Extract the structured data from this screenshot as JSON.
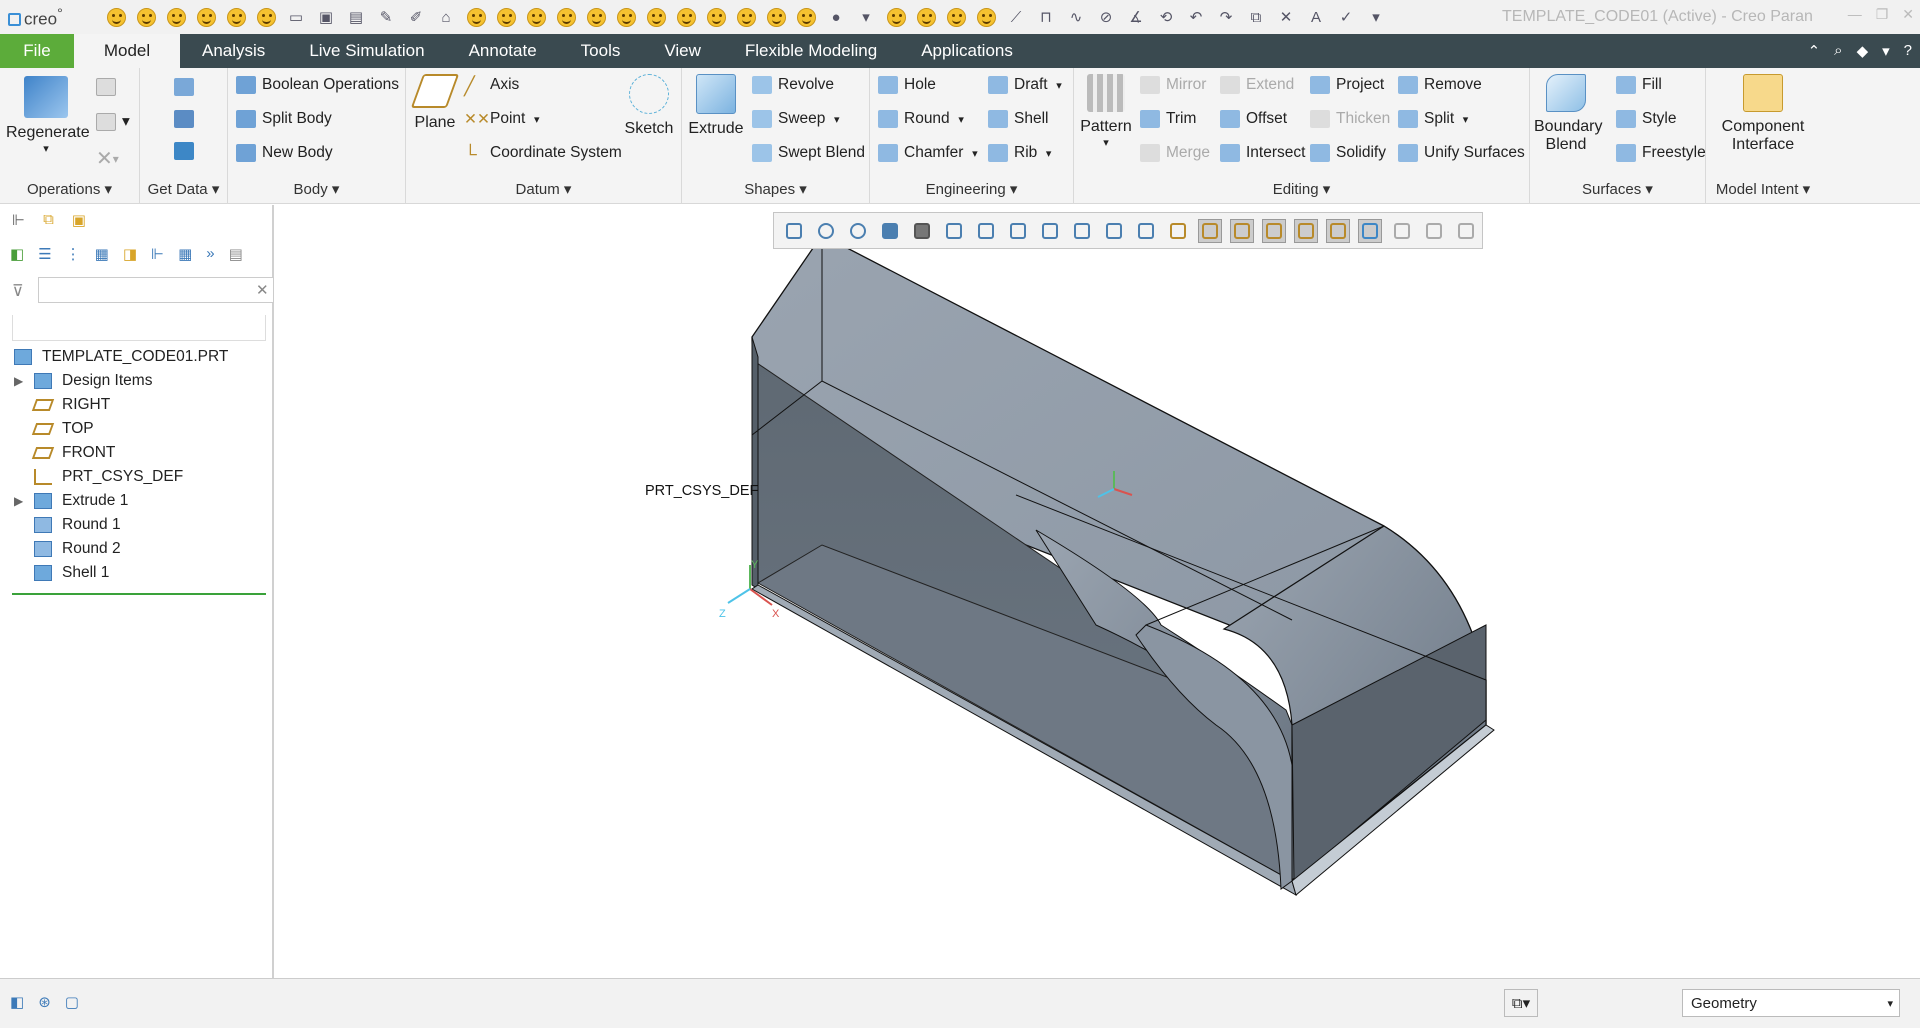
{
  "app": {
    "logo": "creo",
    "window_title": "TEMPLATE_CODE01 (Active) - Creo Paran"
  },
  "menu": {
    "tabs": [
      "File",
      "Model",
      "Analysis",
      "Live Simulation",
      "Annotate",
      "Tools",
      "View",
      "Flexible Modeling",
      "Applications"
    ],
    "active": "Model"
  },
  "ribbon": {
    "operations": {
      "regenerate": "Regenerate",
      "label": "Operations"
    },
    "get_data": {
      "label": "Get Data"
    },
    "body": {
      "boolean": "Boolean Operations",
      "split": "Split Body",
      "new": "New Body",
      "label": "Body"
    },
    "datum": {
      "plane": "Plane",
      "axis": "Axis",
      "point": "Point",
      "csys": "Coordinate System",
      "sketch": "Sketch",
      "label": "Datum"
    },
    "shapes": {
      "extrude": "Extrude",
      "revolve": "Revolve",
      "sweep": "Sweep",
      "swept_blend": "Swept Blend",
      "label": "Shapes"
    },
    "engineering": {
      "hole": "Hole",
      "round": "Round",
      "chamfer": "Chamfer",
      "draft": "Draft",
      "shell": "Shell",
      "rib": "Rib",
      "label": "Engineering"
    },
    "editing": {
      "pattern": "Pattern",
      "mirror": "Mirror",
      "trim": "Trim",
      "merge": "Merge",
      "extend": "Extend",
      "offset": "Offset",
      "intersect": "Intersect",
      "project": "Project",
      "thicken": "Thicken",
      "solidify": "Solidify",
      "remove": "Remove",
      "split": "Split",
      "unify": "Unify Surfaces",
      "label": "Editing"
    },
    "surfaces": {
      "boundary_line1": "Boundary",
      "boundary_line2": "Blend",
      "fill": "Fill",
      "style": "Style",
      "freestyle": "Freestyle",
      "label": "Surfaces"
    },
    "model_intent": {
      "line1": "Component",
      "line2": "Interface",
      "label": "Model Intent"
    }
  },
  "tree": {
    "search_placeholder": "",
    "root": "TEMPLATE_CODE01.PRT",
    "items": [
      {
        "label": "Design Items",
        "icon": "design-items-icon",
        "expandable": true
      },
      {
        "label": "RIGHT",
        "icon": "datum-plane-icon",
        "expandable": false
      },
      {
        "label": "TOP",
        "icon": "datum-plane-icon",
        "expandable": false
      },
      {
        "label": "FRONT",
        "icon": "datum-plane-icon",
        "expandable": false
      },
      {
        "label": "PRT_CSYS_DEF",
        "icon": "csys-icon",
        "expandable": false
      },
      {
        "label": "Extrude 1",
        "icon": "extrude-icon",
        "expandable": true
      },
      {
        "label": "Round 1",
        "icon": "round-icon",
        "expandable": false
      },
      {
        "label": "Round 2",
        "icon": "round-icon",
        "expandable": false
      },
      {
        "label": "Shell 1",
        "icon": "shell-icon",
        "expandable": false
      }
    ]
  },
  "viewport": {
    "csys_label": "PRT_CSYS_DEF",
    "axes": {
      "x": "X",
      "y": "Y",
      "z": "Z"
    }
  },
  "status": {
    "filter": "Geometry"
  },
  "colors": {
    "menubar": "#3a4a50",
    "file_tab": "#5cac3a",
    "model_face": "#8e98a4",
    "model_dark": "#4e5862"
  }
}
